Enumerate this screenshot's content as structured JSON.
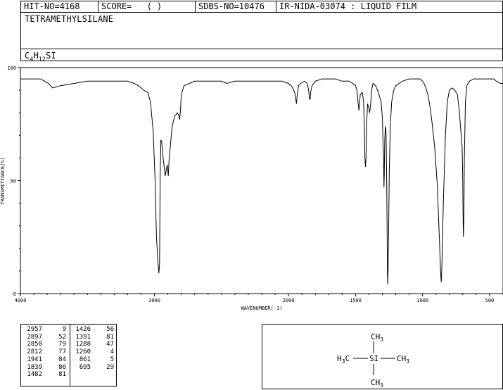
{
  "header": {
    "hit_no": "HIT-NO=4168",
    "score_label": "SCORE=",
    "score_value": "(   )",
    "sdbs_no": "SDBS-NO=10476",
    "ir_info": "IR-NIDA-03074 : LIQUID FILM"
  },
  "compound_name": "TETRAMETHYLSILANE",
  "formula": {
    "c": "C",
    "c_n": "4",
    "h": "H",
    "h_n": "12",
    "si": "SI"
  },
  "chart_data": {
    "type": "line",
    "xlabel": "WAVENUMBER(-1)",
    "ylabel": "TRANSMITTANCE(%)",
    "xlim": [
      4000,
      400
    ],
    "ylim": [
      0,
      100
    ],
    "x_ticks": [
      4000,
      3000,
      2000,
      1500,
      1000,
      500
    ],
    "y_ticks": [
      0,
      50,
      100
    ],
    "grid": false,
    "series": [
      {
        "x": [
          4000,
          3920,
          3850,
          3820,
          3790,
          3760,
          3700,
          3600,
          3500,
          3400,
          3300,
          3200,
          3150,
          3120,
          3100,
          3080,
          3050,
          3030,
          3010,
          2995,
          2985,
          2975,
          2967,
          2962,
          2957,
          2952,
          2945,
          2935,
          2920,
          2905,
          2897,
          2890,
          2880,
          2870,
          2860,
          2850,
          2845,
          2840,
          2830,
          2820,
          2812,
          2805,
          2800,
          2780,
          2740,
          2700,
          2600,
          2500,
          2460,
          2400,
          2300,
          2200,
          2100,
          2050,
          2000,
          1980,
          1960,
          1950,
          1941,
          1935,
          1925,
          1910,
          1880,
          1860,
          1850,
          1843,
          1839,
          1835,
          1825,
          1800,
          1750,
          1700,
          1650,
          1600,
          1550,
          1520,
          1500,
          1490,
          1482,
          1475,
          1465,
          1450,
          1440,
          1434,
          1430,
          1426,
          1422,
          1418,
          1410,
          1400,
          1395,
          1391,
          1387,
          1380,
          1370,
          1350,
          1330,
          1310,
          1300,
          1295,
          1291,
          1288,
          1286,
          1282,
          1278,
          1275,
          1272,
          1268,
          1265,
          1262,
          1260,
          1258,
          1254,
          1248,
          1240,
          1230,
          1215,
          1200,
          1150,
          1100,
          1050,
          1020,
          1000,
          990,
          975,
          960,
          945,
          930,
          910,
          890,
          875,
          866,
          861,
          856,
          845,
          830,
          815,
          800,
          780,
          760,
          740,
          725,
          712,
          705,
          700,
          697,
          695,
          692,
          688,
          680,
          670,
          650,
          620,
          580,
          550,
          500,
          470,
          450,
          420,
          400
        ],
        "y": [
          95,
          95,
          95,
          94,
          93,
          91,
          92,
          93,
          94,
          94,
          94,
          94,
          93,
          92,
          91,
          90,
          89,
          85,
          72,
          50,
          25,
          15,
          9,
          13,
          52,
          68,
          67,
          60,
          52,
          57,
          52,
          60,
          66,
          73,
          76,
          78,
          79,
          79,
          80,
          79,
          77,
          82,
          88,
          92,
          93,
          94,
          94,
          94,
          93,
          94,
          94,
          94,
          94,
          94,
          93,
          92,
          90,
          88,
          84,
          88,
          92,
          93,
          94,
          93,
          90,
          86,
          86,
          89,
          92,
          94,
          95,
          95,
          95,
          94,
          94,
          93,
          92,
          90,
          85,
          81,
          88,
          89,
          85,
          73,
          60,
          56,
          60,
          74,
          84,
          82,
          80,
          82,
          84,
          90,
          93,
          92,
          89,
          85,
          78,
          66,
          60,
          47,
          52,
          68,
          73,
          74,
          70,
          52,
          30,
          10,
          4,
          8,
          25,
          55,
          75,
          85,
          90,
          92,
          94,
          95,
          95,
          95,
          94,
          93,
          91,
          88,
          83,
          76,
          65,
          48,
          25,
          10,
          5,
          12,
          40,
          70,
          85,
          90,
          91,
          90,
          88,
          80,
          70,
          65,
          50,
          30,
          25,
          35,
          60,
          85,
          92,
          94,
          95,
          95,
          95,
          95,
          95,
          94,
          93,
          93
        ]
      }
    ],
    "peak_table": [
      [
        "2957",
        "9"
      ],
      [
        "2897",
        "52"
      ],
      [
        "2850",
        "79"
      ],
      [
        "2812",
        "77"
      ],
      [
        "1941",
        "84"
      ],
      [
        "1839",
        "86"
      ],
      [
        "1482",
        "81"
      ],
      [
        "1426",
        "56"
      ],
      [
        "1391",
        "81"
      ],
      [
        "1288",
        "47"
      ],
      [
        "1260",
        "4"
      ],
      [
        "861",
        "5"
      ],
      [
        "695",
        "29"
      ]
    ]
  },
  "structure": {
    "center": "SI",
    "top": {
      "c": "CH",
      "n": "3"
    },
    "bottom": {
      "c": "CH",
      "n": "3"
    },
    "left": {
      "h": "H",
      "n": "3",
      "c": "C"
    },
    "right": {
      "c": "CH",
      "n": "3"
    }
  }
}
